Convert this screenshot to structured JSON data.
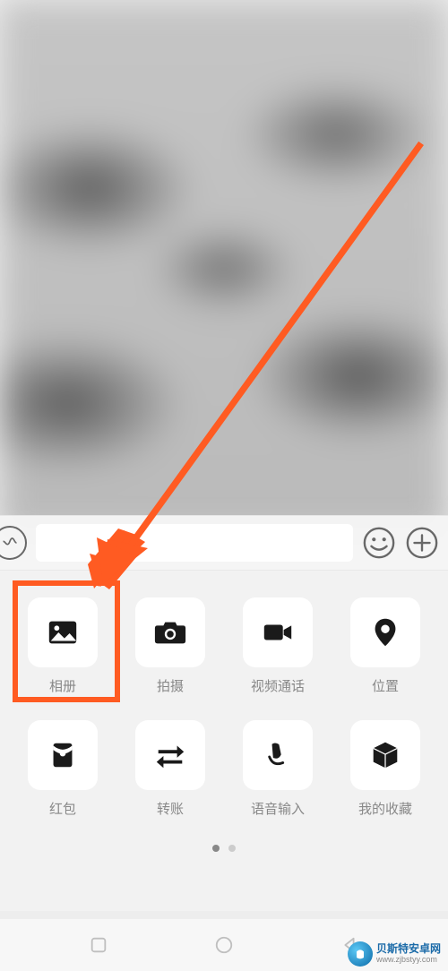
{
  "panel": {
    "items": [
      {
        "name": "album",
        "label": "相册",
        "icon": "photo-icon"
      },
      {
        "name": "camera",
        "label": "拍摄",
        "icon": "camera-icon"
      },
      {
        "name": "videocall",
        "label": "视频通话",
        "icon": "videocam-icon"
      },
      {
        "name": "location",
        "label": "位置",
        "icon": "location-icon"
      },
      {
        "name": "redpacket",
        "label": "红包",
        "icon": "redpacket-icon"
      },
      {
        "name": "transfer",
        "label": "转账",
        "icon": "transfer-icon"
      },
      {
        "name": "voiceinput",
        "label": "语音输入",
        "icon": "mic-icon"
      },
      {
        "name": "favorites",
        "label": "我的收藏",
        "icon": "cube-icon"
      }
    ]
  },
  "watermark": {
    "title": "贝斯特安卓网",
    "url": "www.zjbstyy.com"
  }
}
